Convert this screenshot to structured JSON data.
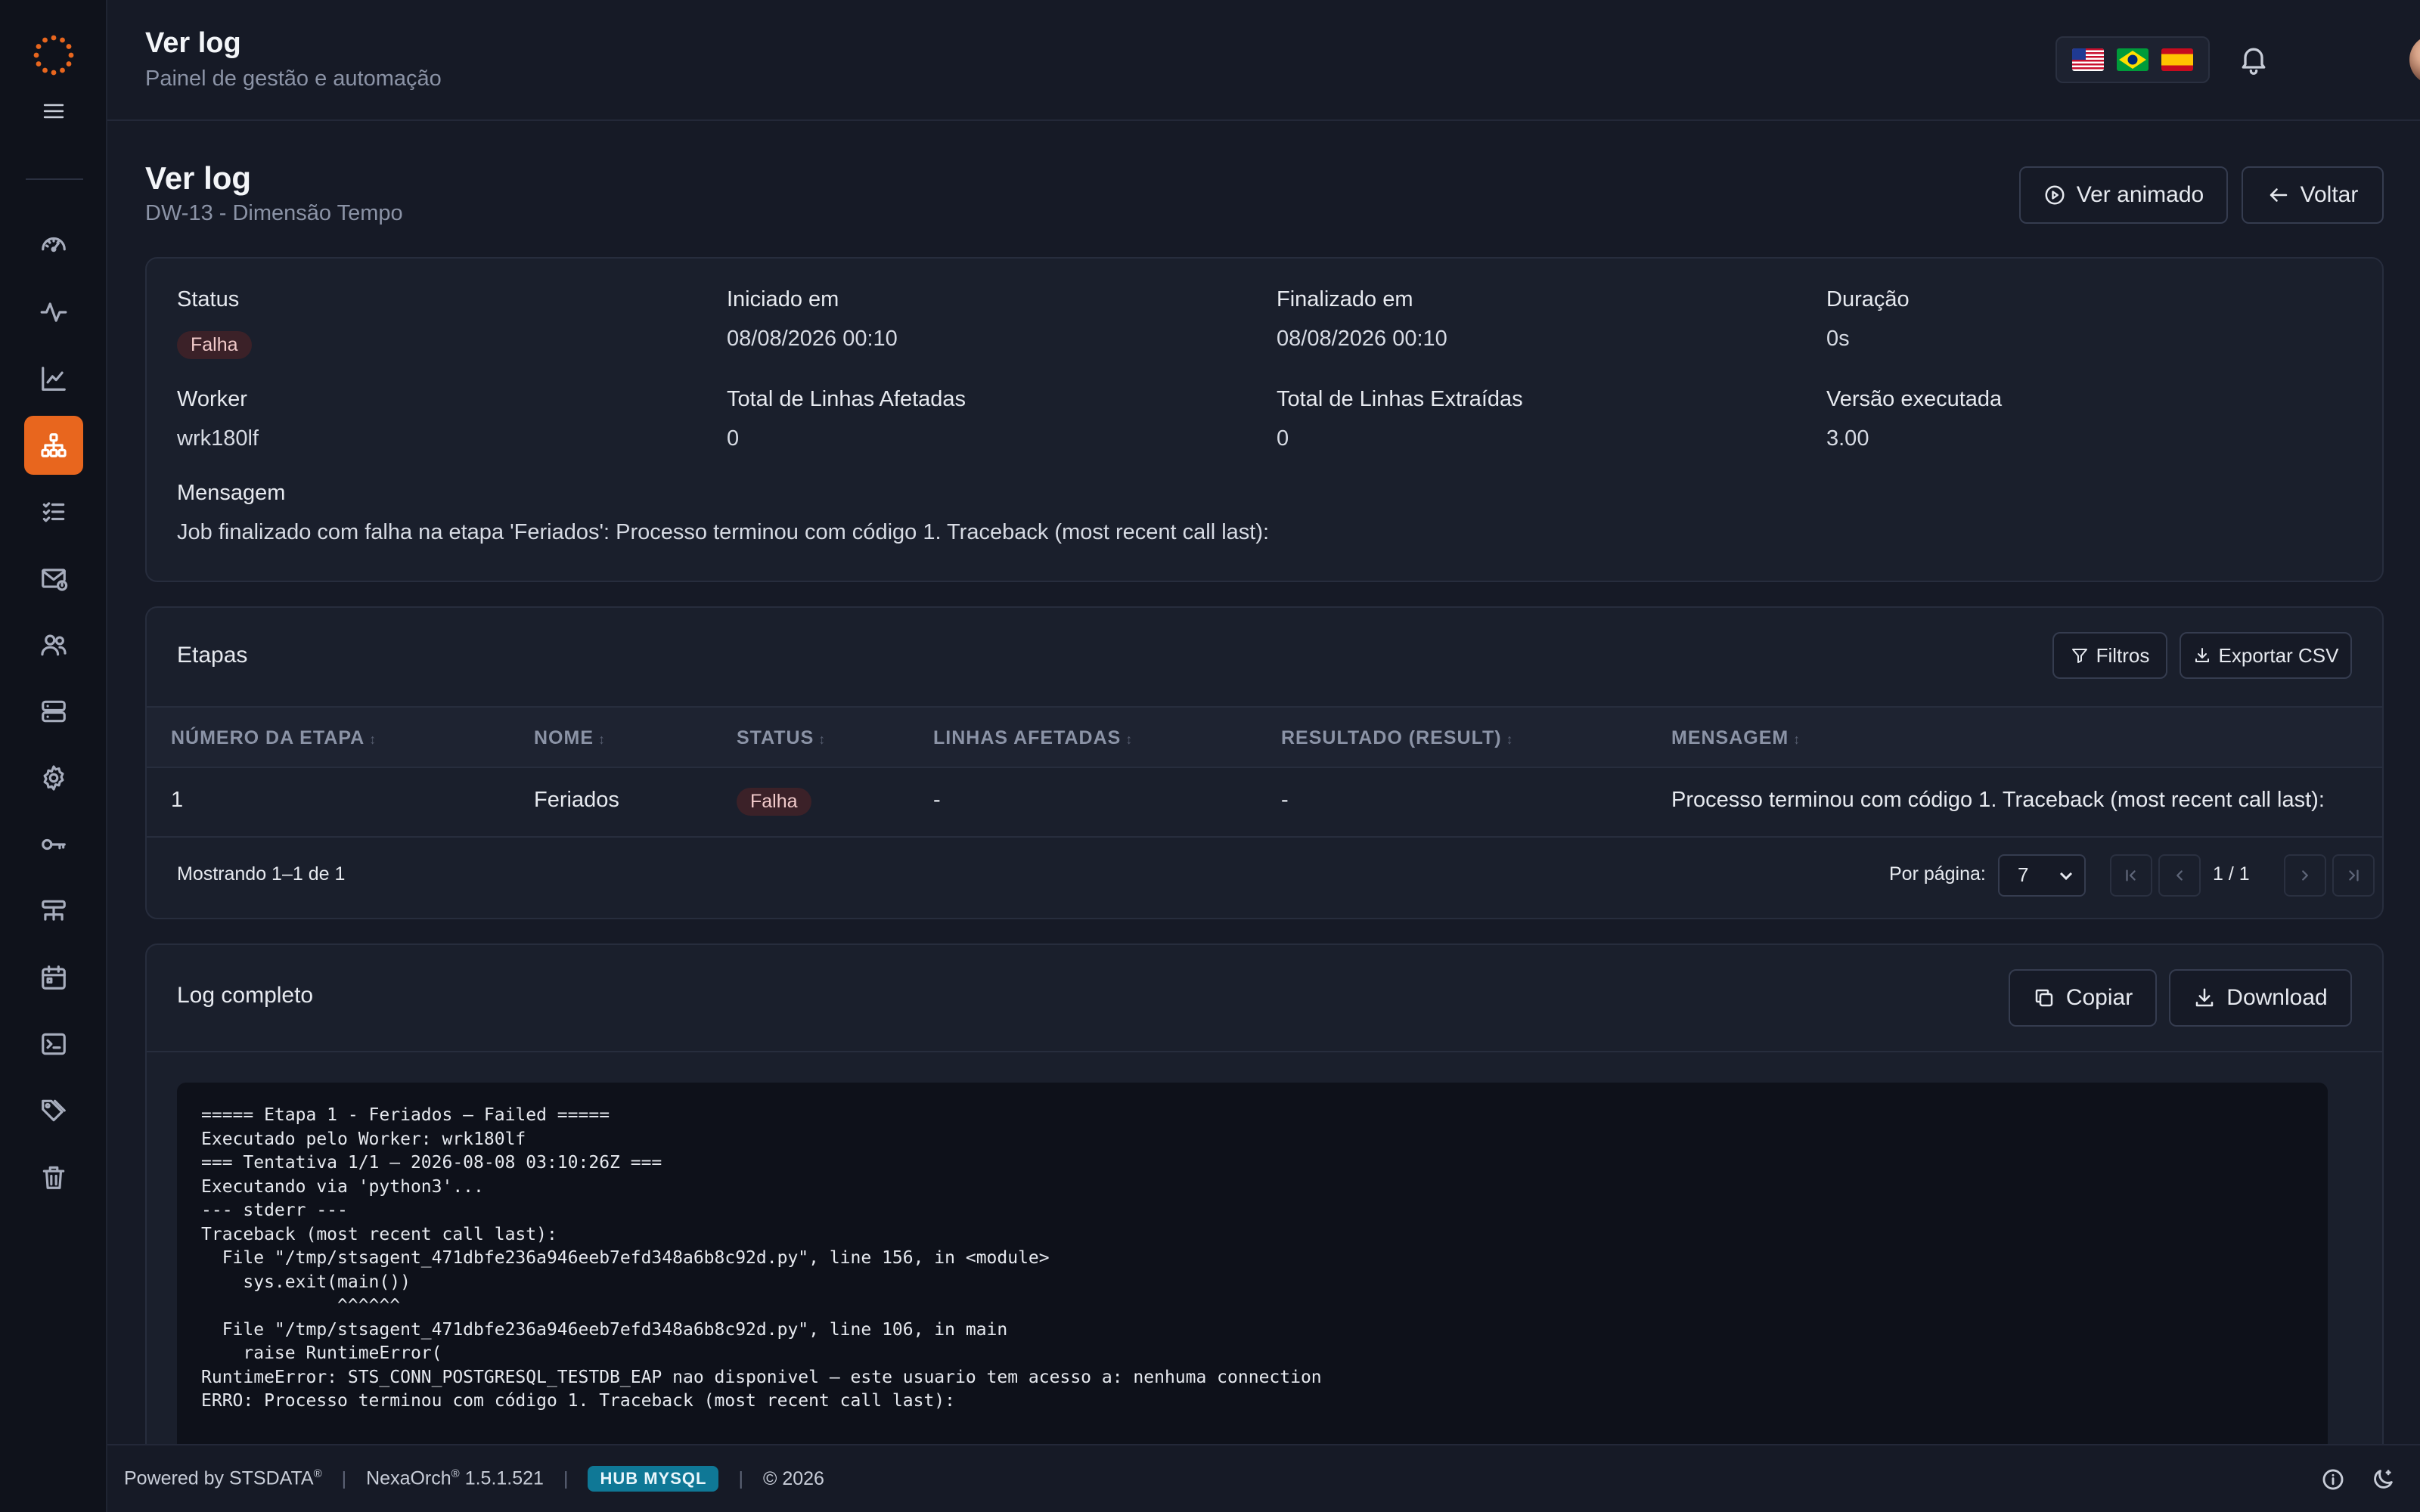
{
  "header": {
    "title": "Ver log",
    "subtitle": "Painel de gestão e automação"
  },
  "page": {
    "title": "Ver log",
    "subtitle": "DW-13 - Dimensão Tempo",
    "animate_label": "Ver animado",
    "back_label": "Voltar"
  },
  "summary": {
    "status_label": "Status",
    "status_value": "Falha",
    "started_label": "Iniciado em",
    "started_value": "08/08/2026 00:10",
    "finished_label": "Finalizado em",
    "finished_value": "08/08/2026 00:10",
    "duration_label": "Duração",
    "duration_value": "0s",
    "worker_label": "Worker",
    "worker_value": "wrk180lf",
    "affected_label": "Total de Linhas Afetadas",
    "affected_value": "0",
    "extracted_label": "Total de Linhas Extraídas",
    "extracted_value": "0",
    "version_label": "Versão executada",
    "version_value": "3.00",
    "message_label": "Mensagem",
    "message_value": "Job finalizado com falha na etapa 'Feriados': Processo terminou com código 1. Traceback (most recent call last):"
  },
  "steps": {
    "title": "Etapas",
    "filters_label": "Filtros",
    "export_label": "Exportar CSV",
    "columns": [
      "NÚMERO DA ETAPA",
      "NOME",
      "STATUS",
      "LINHAS AFETADAS",
      "RESULTADO (RESULT)",
      "MENSAGEM"
    ],
    "rows": [
      {
        "number": "1",
        "name": "Feriados",
        "status": "Falha",
        "affected": "-",
        "result": "-",
        "message": "Processo terminou com código 1. Traceback (most recent call last):"
      }
    ],
    "showing": "Mostrando 1–1 de 1",
    "per_page_label": "Por página:",
    "per_page_value": "7",
    "page_indicator": "1 / 1"
  },
  "log": {
    "title": "Log completo",
    "copy_label": "Copiar",
    "download_label": "Download",
    "content": "===== Etapa 1 - Feriados — Failed =====\nExecutado pelo Worker: wrk180lf\n=== Tentativa 1/1 — 2026-08-08 03:10:26Z ===\nExecutando via 'python3'...\n--- stderr ---\nTraceback (most recent call last):\n  File \"/tmp/stsagent_471dbfe236a946eeb7efd348a6b8c92d.py\", line 156, in <module>\n    sys.exit(main())\n             ^^^^^^\n  File \"/tmp/stsagent_471dbfe236a946eeb7efd348a6b8c92d.py\", line 106, in main\n    raise RuntimeError(\nRuntimeError: STS_CONN_POSTGRESQL_TESTDB_EAP nao disponivel — este usuario tem acesso a: nenhuma connection\nERRO: Processo terminou com código 1. Traceback (most recent call last):"
  },
  "footer": {
    "powered": "Powered by STSDATA",
    "product": "NexaOrch",
    "version": "1.5.1.521",
    "hub": "HUB MYSQL",
    "copyright": "© 2026"
  },
  "icons": {
    "sidebar": [
      "dashboard-icon",
      "activity-icon",
      "chart-line-icon",
      "workflow-icon",
      "list-icon",
      "mail-alert-icon",
      "users-icon",
      "server-icon",
      "gear-icon",
      "key-icon",
      "sliders-icon",
      "calendar-icon",
      "terminal-icon",
      "tags-icon",
      "trash-icon"
    ]
  },
  "colors": {
    "accent": "#e8661e",
    "fail_badge_bg": "#3b2128",
    "hub_badge": "#0f7896"
  }
}
